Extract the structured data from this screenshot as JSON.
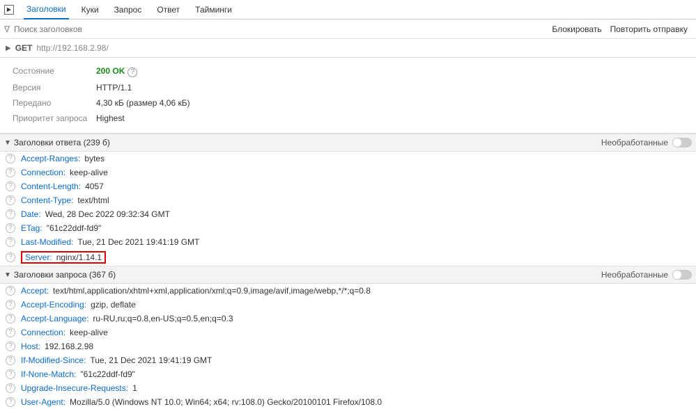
{
  "tabs": {
    "t0": "Заголовки",
    "t1": "Куки",
    "t2": "Запрос",
    "t3": "Ответ",
    "t4": "Тайминги"
  },
  "filter": {
    "placeholder": "Поиск заголовков",
    "block": "Блокировать",
    "resend": "Повторить отправку"
  },
  "request": {
    "method": "GET",
    "url": "http://192.168.2.98/"
  },
  "summary": {
    "state_label": "Состояние",
    "state_value": "200 OK",
    "version_label": "Версия",
    "version_value": "HTTP/1.1",
    "transferred_label": "Передано",
    "transferred_value": "4,30 кБ (размер 4,06 кБ)",
    "priority_label": "Приоритет запроса",
    "priority_value": "Highest"
  },
  "sections": {
    "response_title": "Заголовки ответа (239 б)",
    "request_title": "Заголовки запроса (367 б)",
    "raw_label": "Необработанные"
  },
  "response_headers": [
    {
      "name": "Accept-Ranges:",
      "value": "bytes"
    },
    {
      "name": "Connection:",
      "value": "keep-alive"
    },
    {
      "name": "Content-Length:",
      "value": "4057"
    },
    {
      "name": "Content-Type:",
      "value": "text/html"
    },
    {
      "name": "Date:",
      "value": "Wed, 28 Dec 2022 09:32:34 GMT"
    },
    {
      "name": "ETag:",
      "value": "\"61c22ddf-fd9\""
    },
    {
      "name": "Last-Modified:",
      "value": "Tue, 21 Dec 2021 19:41:19 GMT"
    },
    {
      "name": "Server:",
      "value": "nginx/1.14.1"
    }
  ],
  "request_headers": [
    {
      "name": "Accept:",
      "value": "text/html,application/xhtml+xml,application/xml;q=0.9,image/avif,image/webp,*/*;q=0.8"
    },
    {
      "name": "Accept-Encoding:",
      "value": "gzip, deflate"
    },
    {
      "name": "Accept-Language:",
      "value": "ru-RU,ru;q=0.8,en-US;q=0.5,en;q=0.3"
    },
    {
      "name": "Connection:",
      "value": "keep-alive"
    },
    {
      "name": "Host:",
      "value": "192.168.2.98"
    },
    {
      "name": "If-Modified-Since:",
      "value": "Tue, 21 Dec 2021 19:41:19 GMT"
    },
    {
      "name": "If-None-Match:",
      "value": "\"61c22ddf-fd9\""
    },
    {
      "name": "Upgrade-Insecure-Requests:",
      "value": "1"
    },
    {
      "name": "User-Agent:",
      "value": "Mozilla/5.0 (Windows NT 10.0; Win64; x64; rv:108.0) Gecko/20100101 Firefox/108.0"
    }
  ]
}
